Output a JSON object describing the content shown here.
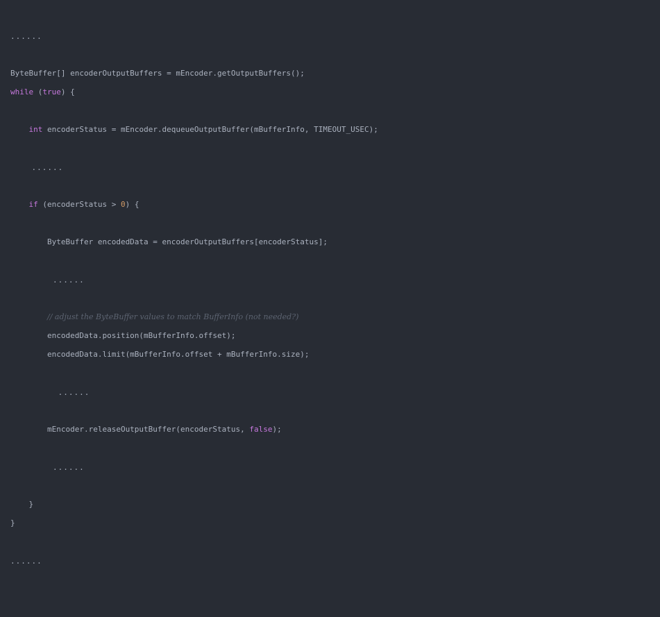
{
  "code": {
    "l01_ellipsis": "......",
    "l02_text": "ByteBuffer[] encoderOutputBuffers = mEncoder.getOutputBuffers();",
    "l03_kw_while": "while",
    "l03_open": " (",
    "l03_kw_true": "true",
    "l03_close": ") {",
    "l04_indent": "    ",
    "l04_kw_int": "int",
    "l04_text": " encoderStatus = mEncoder.dequeueOutputBuffer(mBufferInfo, TIMEOUT_USEC);",
    "l05_text": "    ......",
    "l06_indent": "    ",
    "l06_kw_if": "if",
    "l06_text": " (encoderStatus > ",
    "l06_num": "0",
    "l06_end": ") {",
    "l07_text": "        ByteBuffer encodedData = encoderOutputBuffers[encoderStatus];",
    "l08_text": "        ......",
    "l09_indent": "        ",
    "l09_comment": "// adjust the ByteBuffer values to match BufferInfo (not needed?)",
    "l10_text": "        encodedData.position(mBufferInfo.offset);",
    "l11_text": "        encodedData.limit(mBufferInfo.offset + mBufferInfo.size);",
    "l12_text": "         ......",
    "l13_text": "        mEncoder.releaseOutputBuffer(encoderStatus, ",
    "l13_kw_false": "false",
    "l13_end": ");",
    "l14_text": "        ......",
    "l15_text": "    }",
    "l16_text": "}",
    "l17_ellipsis": "......"
  },
  "colors": {
    "background": "#282c34",
    "text": "#abb2bf",
    "keyword": "#c678dd",
    "number": "#d19a66",
    "comment": "#5c6370"
  }
}
